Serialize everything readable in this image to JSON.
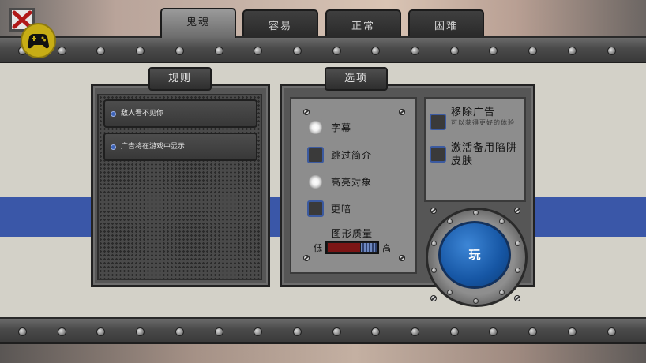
{
  "tabs": [
    {
      "label": "鬼魂",
      "active": true
    },
    {
      "label": "容易",
      "active": false
    },
    {
      "label": "正常",
      "active": false
    },
    {
      "label": "困难",
      "active": false
    }
  ],
  "rules": {
    "title": "规则",
    "items": [
      "敌人看不见你",
      "广告将在游戏中显示"
    ]
  },
  "options": {
    "title": "选项",
    "items": [
      {
        "label": "字幕",
        "checked": true
      },
      {
        "label": "跳过简介",
        "checked": false
      },
      {
        "label": "高亮对象",
        "checked": true
      },
      {
        "label": "更暗",
        "checked": false
      }
    ],
    "quality": {
      "title": "图形质量",
      "low": "低",
      "high": "高",
      "level": 3,
      "levels": 3
    }
  },
  "extras": {
    "remove_ads": "移除广告",
    "remove_ads_sub": "可以获得更好的体验",
    "backup_trap": "激活备用陷阱皮肤"
  },
  "play_label": "玩",
  "colors": {
    "accent_blue": "#1656a4",
    "stripe_blue": "#3a57a8",
    "gamepad_yellow": "#c7ad15",
    "quality_red": "#7c1515"
  },
  "icons": {
    "close": "close-icon",
    "gamepad": "gamepad-icon"
  }
}
